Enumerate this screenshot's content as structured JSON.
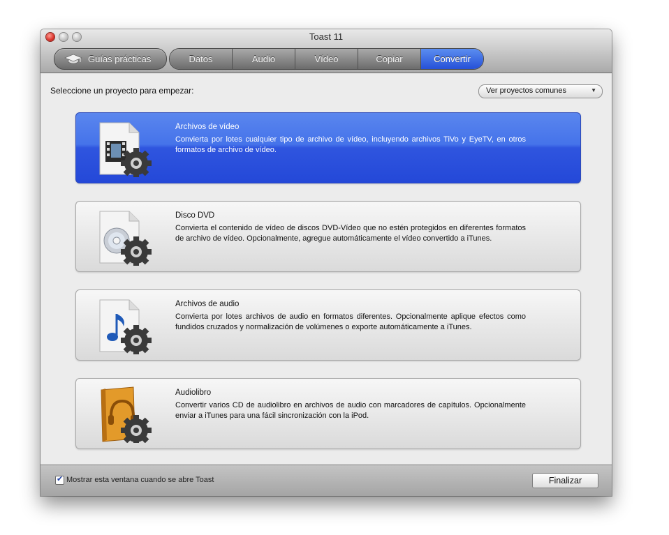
{
  "window": {
    "title": "Toast 11"
  },
  "toolbar": {
    "guide_label": "Guías prácticas",
    "tabs": [
      {
        "label": "Datos",
        "active": false
      },
      {
        "label": "Audio",
        "active": false
      },
      {
        "label": "Vídeo",
        "active": false
      },
      {
        "label": "Copiar",
        "active": false
      },
      {
        "label": "Convertir",
        "active": true
      }
    ]
  },
  "main": {
    "prompt": "Seleccione un proyecto para empezar:",
    "dropdown_value": "Ver proyectos comunes",
    "projects": [
      {
        "title": "Archivos de vídeo",
        "description": "Convierta por lotes cualquier tipo de archivo de vídeo, incluyendo archivos TiVo y EyeTV, en otros formatos de archivo de vídeo.",
        "icon": "video-file-icon",
        "selected": true
      },
      {
        "title": "Disco DVD",
        "description": "Convierta el contenido de vídeo de discos DVD-Vídeo que no estén protegidos en diferentes formatos de archivo de vídeo. Opcionalmente, agregue automáticamente el vídeo convertido a iTunes.",
        "icon": "dvd-disc-icon",
        "selected": false
      },
      {
        "title": "Archivos de audio",
        "description": "Convierta por lotes archivos de audio en formatos diferentes. Opcionalmente aplique efectos como fundidos cruzados y normalización de volúmenes o exporte automáticamente a iTunes.",
        "icon": "audio-file-icon",
        "selected": false
      },
      {
        "title": "Audiolibro",
        "description": "Convertir varios CD de audiolibro en archivos de audio con marcadores de capítulos. Opcionalmente enviar a iTunes para una fácil sincronización con la iPod.",
        "icon": "audiobook-icon",
        "selected": false
      }
    ]
  },
  "footer": {
    "checkbox_label": "Mostrar esta ventana cuando se abre Toast",
    "checkbox_checked": true,
    "finish_label": "Finalizar"
  },
  "colors": {
    "accent": "#2f55df",
    "selected_card_top": "#5a86ee"
  }
}
